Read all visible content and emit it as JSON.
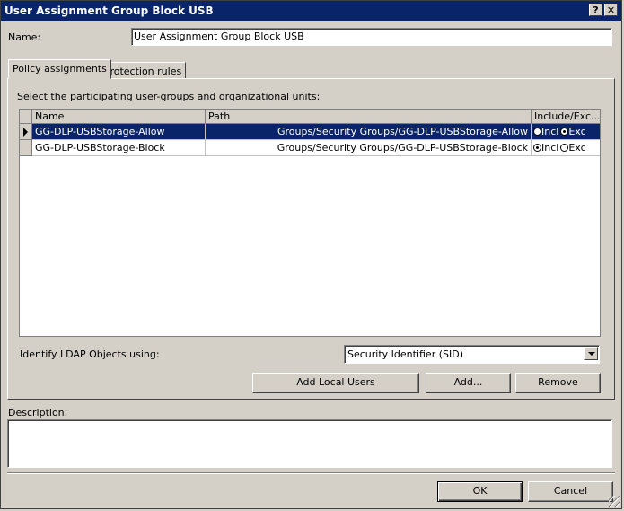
{
  "window": {
    "title": "User Assignment Group Block USB",
    "help_label": "?",
    "close_label": "X"
  },
  "name_field": {
    "label": "Name:",
    "value": "User Assignment Group Block USB"
  },
  "tabs": [
    {
      "label": "Policy assignments",
      "active": true
    },
    {
      "label": "Protection rules",
      "active": false
    }
  ],
  "policy": {
    "instruction": "Select the participating user-groups and organizational units:",
    "columns": [
      "Name",
      "Path",
      "Include/Exc..."
    ],
    "rows": [
      {
        "name": "GG-DLP-USBStorage-Allow",
        "path": "Groups/Security Groups/GG-DLP-USBStorage-Allow",
        "incl": "Incl",
        "exc": "Exc",
        "selected_option": "exc",
        "selected": true
      },
      {
        "name": "GG-DLP-USBStorage-Block",
        "path": "Groups/Security Groups/GG-DLP-USBStorage-Block",
        "incl": "Incl",
        "exc": "Exc",
        "selected_option": "incl",
        "selected": false
      }
    ],
    "ldap_label": "Identify LDAP Objects using:",
    "ldap_value": "Security Identifier (SID)",
    "add_local_users": "Add Local Users",
    "add": "Add...",
    "remove": "Remove"
  },
  "description": {
    "label": "Description:",
    "value": ""
  },
  "footer": {
    "ok": "OK",
    "cancel": "Cancel"
  }
}
